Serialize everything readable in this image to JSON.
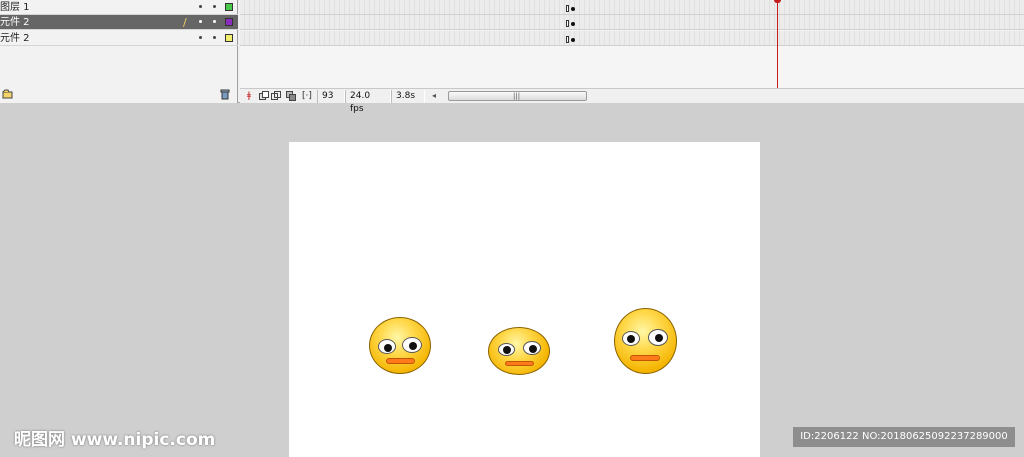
{
  "timeline": {
    "layers": [
      {
        "name": "图层 1",
        "selected": false,
        "color": "#49c949",
        "edit_icon": ""
      },
      {
        "name": "元件 2",
        "selected": true,
        "color": "#8b2bbf",
        "edit_icon": "pencil-icon"
      },
      {
        "name": "元件 2",
        "selected": false,
        "color": "#f2ef6a",
        "edit_icon": ""
      }
    ],
    "footer": {
      "new_layer_icon": "new-layer-icon",
      "delete_icon": "trash-icon"
    },
    "frame_controls": {
      "current_frame": "93",
      "fps": "24.0 fps",
      "elapsed": "3.8s"
    },
    "playhead_color": "#c41b1b"
  },
  "stage": {
    "background": "#ffffff",
    "smileys": [
      "smiley-left",
      "smiley-center",
      "smiley-right"
    ]
  },
  "watermark": {
    "left": "昵图网 www.nipic.com",
    "right": "ID:2206122 NO:20180625092237289000"
  }
}
